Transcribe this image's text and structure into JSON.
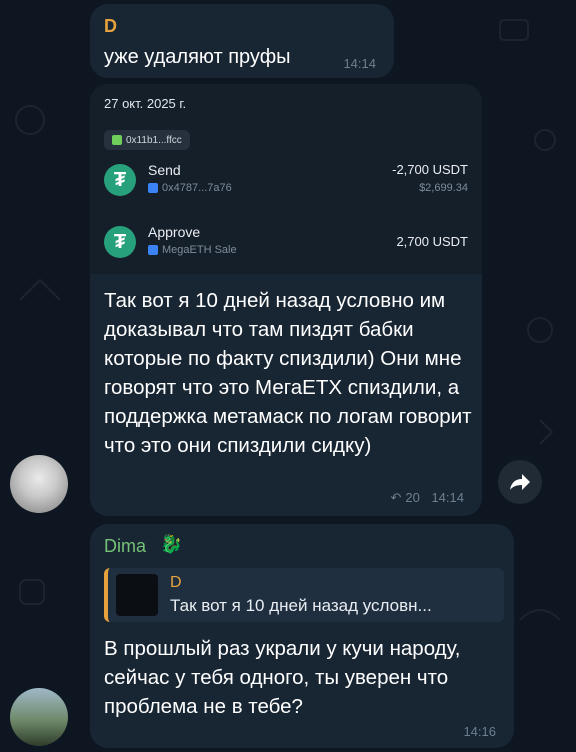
{
  "messages": [
    {
      "sender": "D",
      "text": "уже удаляют пруфы",
      "time": "14:14"
    },
    {
      "embed": {
        "date": "27 окт. 2025 г.",
        "wallet": "0x11b1...ffcc",
        "transactions": [
          {
            "name": "Send",
            "sub": "0x4787...7a76",
            "amount": "-2,700 USDT",
            "usd": "$2,699.34"
          },
          {
            "name": "Approve",
            "sub": "MegaETH Sale",
            "amount": "2,700 USDT"
          }
        ]
      },
      "text": "Так вот я 10 дней назад условно им доказывал что там пиздят бабки которые по факту спиздили) Они мне говорят что это МегаЕТХ спиздили, а поддержка метамаск по логам говорит что это они спиздили сидку)",
      "replies": "20",
      "time": "14:14"
    },
    {
      "sender": "Dima",
      "quote": {
        "name": "D",
        "text": "Так вот я 10 дней назад условн..."
      },
      "text": "В прошлый раз украли у кучи народу, сейчас у тебя одного, ты уверен что проблема не в тебе?",
      "time": "14:16"
    }
  ],
  "colors": {
    "background": "#0e1621",
    "bubble": "#182533",
    "sender_d": "#e6a23c",
    "sender_dima": "#74c276",
    "usdt": "#26a17b"
  }
}
